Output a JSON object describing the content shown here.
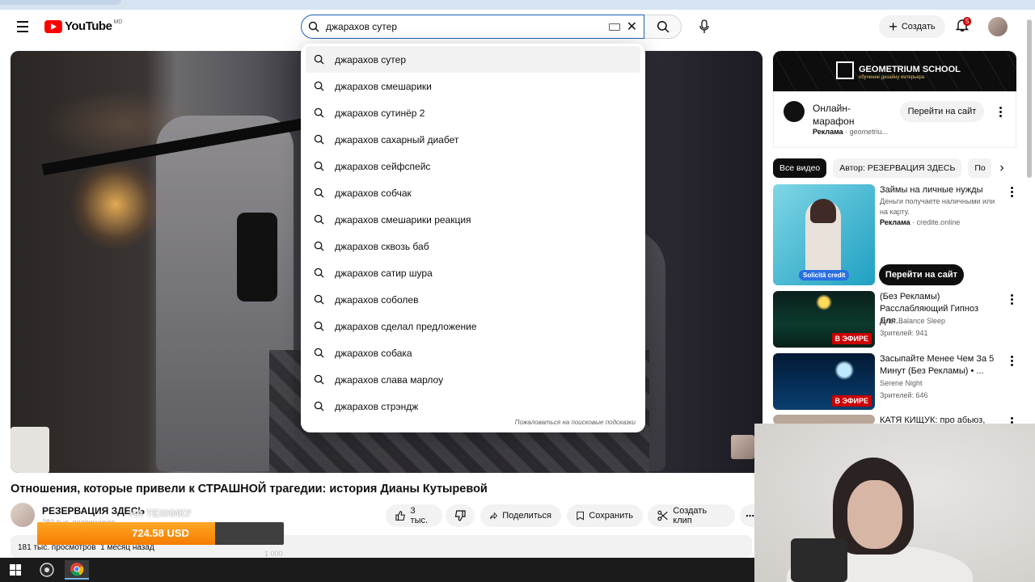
{
  "masthead": {
    "logo_text": "YouTube",
    "country_code": "MD",
    "search_value": "джарахов сутер",
    "create_label": "Создать",
    "notifications_count": "5"
  },
  "suggestions": {
    "items": [
      "джарахов сутер",
      "джарахов смешарики",
      "джарахов сутинёр 2",
      "джарахов сахарный диабет",
      "джарахов сейфспейс",
      "джарахов собчак",
      "джарахов смешарики реакция",
      "джарахов сквозь баб",
      "джарахов сатир шура",
      "джарахов соболев",
      "джарахов сделал предложение",
      "джарахов собака",
      "джарахов слава марлоу",
      "джарахов стрэндж"
    ],
    "report_label": "Пожаловаться на поисковые подсказки"
  },
  "video": {
    "title": "Отношения, которые привели к СТРАШНОЙ трагедии: история Дианы Кутыревой",
    "channel": "РЕЗЕРВАЦИЯ ЗДЕСЬ",
    "subscribers": "283 тыс. подписчиков",
    "likes": "3 тыс.",
    "share_label": "Поделиться",
    "save_label": "Сохранить",
    "clip_label": "Создать клип",
    "views": "181 тыс. просмотров",
    "date": "1 месяц назад"
  },
  "donation": {
    "ghost_text": "НА ТЕХНИКУ",
    "amount": "724.58 USD",
    "target": "1 000",
    "progress_fraction": 0.72
  },
  "sidebar": {
    "ad_banner": {
      "brand": "GEOMETRIUM SCHOOL",
      "tagline": "обучение дизайну интерьера"
    },
    "ad_card": {
      "title": "Онлайн-марафон",
      "ad_label": "Реклама",
      "domain": "geometriu...",
      "cta": "Перейти на сайт"
    },
    "chips": [
      "Все видео",
      "Автор: РЕЗЕРВАЦИЯ ЗДЕСЬ",
      "По"
    ],
    "recs": [
      {
        "title": "Займы на личные нужды",
        "sub": "Деньги получаете наличными или на карту.",
        "ad_label": "Реклама",
        "domain": "credite.online",
        "cta": "Перейти на сайт",
        "thumb_text": "Solicită credit"
      },
      {
        "title": "(Без Рекламы) Расслабляющий Гипноз Для...",
        "channel": "Inner Balance Sleep",
        "views": "Зрителей: 941",
        "live": "В ЭФИРЕ"
      },
      {
        "title": "Засыпайте Менее Чем За 5 Минут (Без Рекламы) • ...",
        "channel": "Serene Night",
        "views": "Зрителей: 646",
        "live": "В ЭФИРЕ"
      },
      {
        "title": "КАТЯ КИЩУК: про абьюз,"
      }
    ]
  },
  "colors": {
    "accent": "#1c62b9",
    "brand_red": "#ff0000",
    "donation_orange": "#f57c00"
  }
}
